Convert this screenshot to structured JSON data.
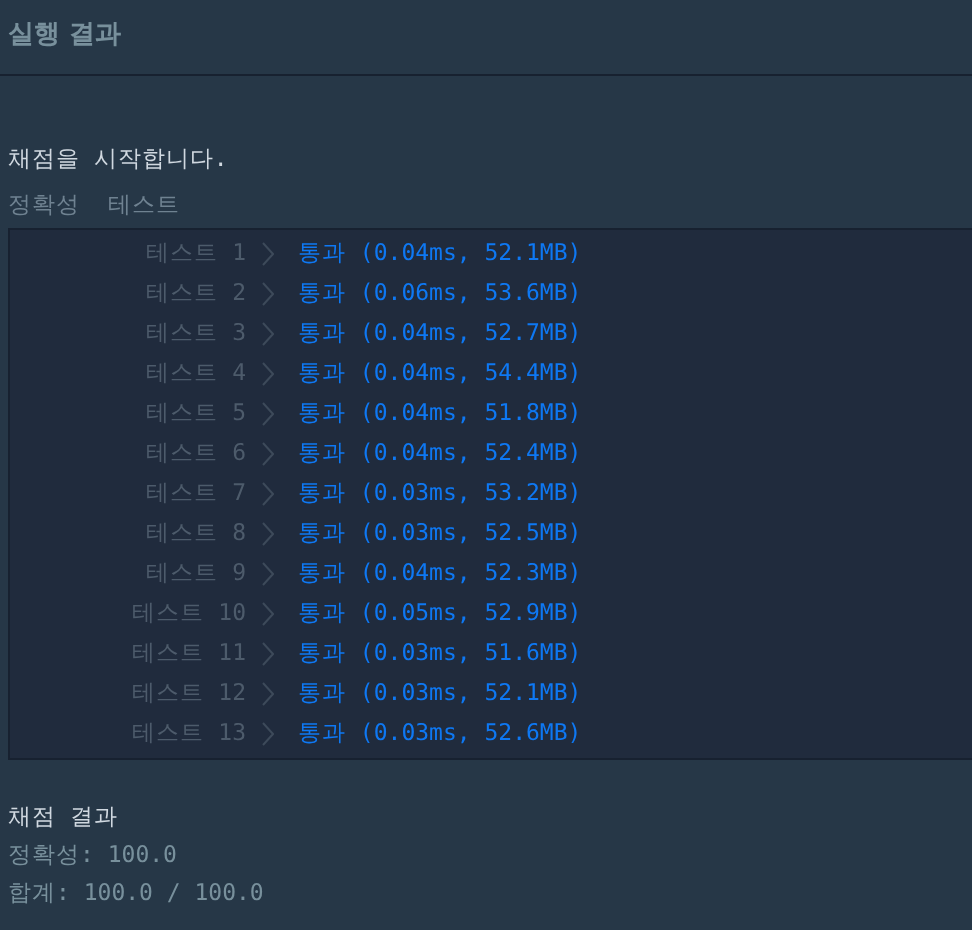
{
  "header": {
    "title": "실행 결과"
  },
  "output": {
    "intro": "채점을 시작합니다.",
    "section": "정확성  테스트",
    "tests": [
      {
        "label": "테스트 1",
        "result": "통과 (0.04ms, 52.1MB)"
      },
      {
        "label": "테스트 2",
        "result": "통과 (0.06ms, 53.6MB)"
      },
      {
        "label": "테스트 3",
        "result": "통과 (0.04ms, 52.7MB)"
      },
      {
        "label": "테스트 4",
        "result": "통과 (0.04ms, 54.4MB)"
      },
      {
        "label": "테스트 5",
        "result": "통과 (0.04ms, 51.8MB)"
      },
      {
        "label": "테스트 6",
        "result": "통과 (0.04ms, 52.4MB)"
      },
      {
        "label": "테스트 7",
        "result": "통과 (0.03ms, 53.2MB)"
      },
      {
        "label": "테스트 8",
        "result": "통과 (0.03ms, 52.5MB)"
      },
      {
        "label": "테스트 9",
        "result": "통과 (0.04ms, 52.3MB)"
      },
      {
        "label": "테스트 10",
        "result": "통과 (0.05ms, 52.9MB)"
      },
      {
        "label": "테스트 11",
        "result": "통과 (0.03ms, 51.6MB)"
      },
      {
        "label": "테스트 12",
        "result": "통과 (0.03ms, 52.1MB)"
      },
      {
        "label": "테스트 13",
        "result": "통과 (0.03ms, 52.6MB)"
      }
    ],
    "summary_title": "채점 결과",
    "accuracy": "정확성: 100.0",
    "total": "합계: 100.0 / 100.0"
  }
}
